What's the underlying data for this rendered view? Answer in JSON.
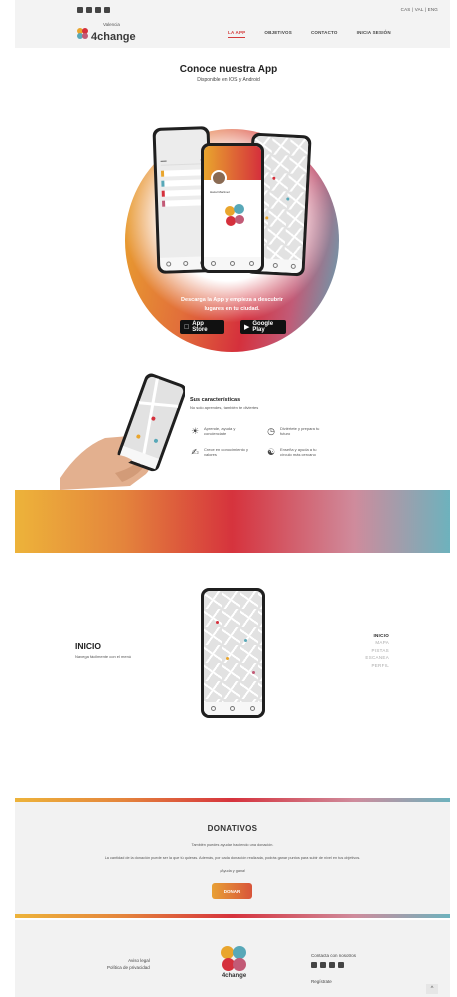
{
  "header": {
    "social_icons": [
      "instagram-icon",
      "facebook-icon",
      "youtube-icon",
      "mail-icon"
    ],
    "languages": "CAS | VAL | ENG",
    "logo": {
      "small": "Valencia",
      "big": "4change"
    },
    "nav": [
      {
        "label": "LA APP",
        "active": true
      },
      {
        "label": "OBJETIVOS",
        "active": false
      },
      {
        "label": "CONTACTO",
        "active": false
      },
      {
        "label": "INICIA SESIÓN",
        "active": false
      }
    ]
  },
  "hero": {
    "title": "Conoce nuestra App",
    "subtitle": "Disponible en IOS y Android",
    "download_text": "Descarga la App y empieza a descubrir lugares en tu ciudad.",
    "app_store": {
      "small": "Download on the",
      "label": "App Store"
    },
    "google_play": {
      "small": "GET IT ON",
      "label": "Google Play"
    },
    "profile_name": "Hazel Martinez"
  },
  "features": {
    "title": "Sus características",
    "subtitle": "No solo aprendes, también te diviertes",
    "items": [
      {
        "icon": "lightbulb-icon",
        "text": "Aprende, ayuda y concienciate"
      },
      {
        "icon": "clock-icon",
        "text": "Diviértete y prepara tu futuro"
      },
      {
        "icon": "handshake-icon",
        "text": "Crece en conocimiento y valores"
      },
      {
        "icon": "people-icon",
        "text": "Enseña y ayuda a tu círculo más cercano"
      }
    ]
  },
  "app_nav": {
    "title": "INICIO",
    "subtitle": "Navega fácilmente con el menú",
    "menu": [
      {
        "label": "INICIO",
        "active": true
      },
      {
        "label": "MAPA",
        "active": false
      },
      {
        "label": "PISTAS",
        "active": false
      },
      {
        "label": "ESCANEA",
        "active": false
      },
      {
        "label": "PERFIL",
        "active": false
      }
    ]
  },
  "donations": {
    "title": "DONATIVOS",
    "line1": "También puedes ayudar haciendo una donación.",
    "line2": "La cantidad de la donación puede ser la que tú quieras. Además, por cada donación realizada, podrás ganar puntos para subir de nivel en tus objetivos.",
    "line3": "¡Ayuda y gana!",
    "button": "DONAR"
  },
  "footer": {
    "legal": "Aviso legal",
    "privacy": "Política de privacidad",
    "logo_small": "Valencia",
    "logo_big": "4change",
    "contact": "Contacta con nosotros",
    "social_icons": [
      "instagram-icon",
      "facebook-icon",
      "youtube-icon",
      "mail-icon"
    ],
    "register": "Regístrate",
    "to_top": "^"
  },
  "colors": {
    "accent_red": "#d43a3a",
    "gradient": [
      "#edb33a",
      "#e4843c",
      "#d6333d",
      "#cf8b9c",
      "#6db2bd"
    ],
    "logo_petals": [
      "#e9a52d",
      "#d5303c",
      "#58a8b8",
      "#c25a76"
    ]
  }
}
